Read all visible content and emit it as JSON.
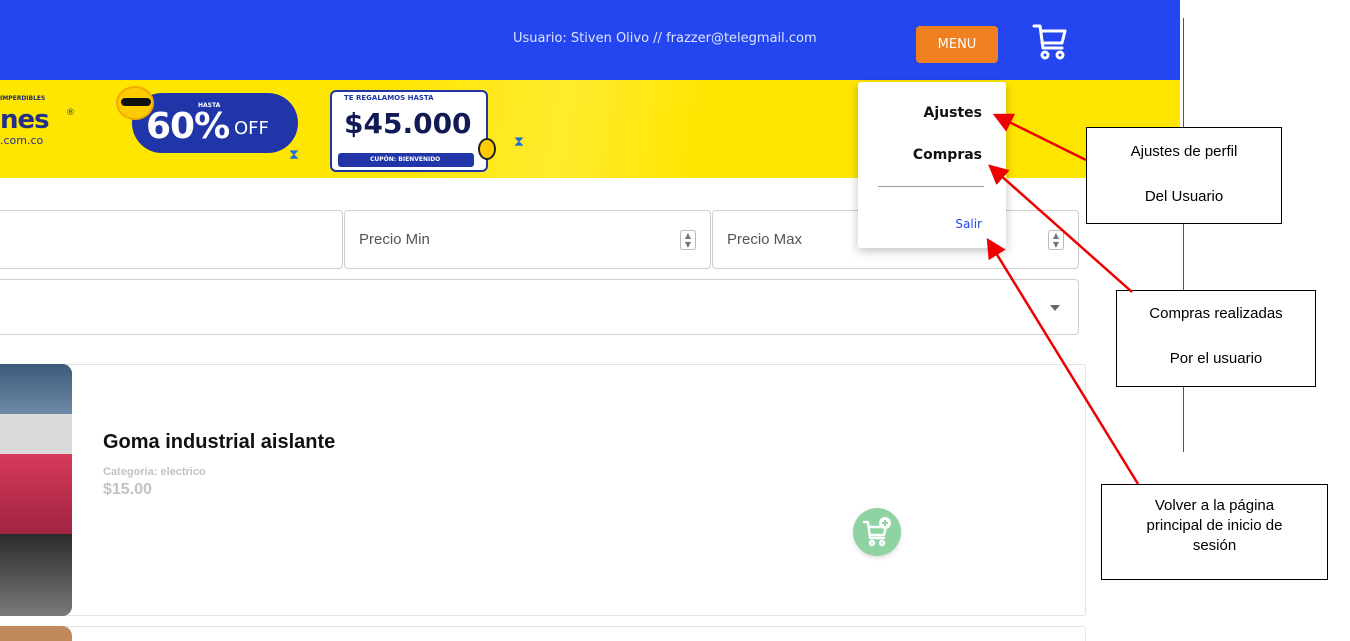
{
  "header": {
    "user_label": "Usuario: Stiven Olivo // frazzer@telegmail.com",
    "menu_label": "MENU",
    "cart_icon": "cart-icon",
    "background_color": "#2346f0",
    "menu_button_color": "#ef7f1f"
  },
  "banner": {
    "background_color": "#ffe600",
    "small_text": "IMPERDIBLES",
    "brand_text": "nes",
    "registered_mark": "®",
    "domain_text": ".com.co",
    "discount_prefix": "HASTA",
    "discount_value": "60%",
    "discount_suffix": "OFF",
    "coupon_header": "TE REGALAMOS HASTA",
    "coupon_amount": "$45.000",
    "coupon_code": "CUPÓN: BIENVENIDO"
  },
  "filters": {
    "search_placeholder": "",
    "price_min_placeholder": "Precio Min",
    "price_max_placeholder": "Precio Max",
    "category_value": ""
  },
  "products": [
    {
      "name": "Goma industrial aislante",
      "category": "Categoría: electrico",
      "price": "$15.00",
      "add_to_cart_icon": "cart-plus-icon"
    }
  ],
  "menu_dropdown": {
    "items": [
      {
        "label": "Ajustes"
      },
      {
        "label": "Compras"
      }
    ],
    "logout_label": "Salir"
  },
  "annotations": [
    {
      "lines": [
        "Ajustes de perfil",
        "Del Usuario"
      ]
    },
    {
      "lines": [
        "Compras realizadas",
        "Por el usuario"
      ]
    },
    {
      "lines": [
        "Volver a la página",
        "principal de inicio de",
        "sesión"
      ]
    }
  ],
  "annotation_arrow_color": "#ee0000"
}
